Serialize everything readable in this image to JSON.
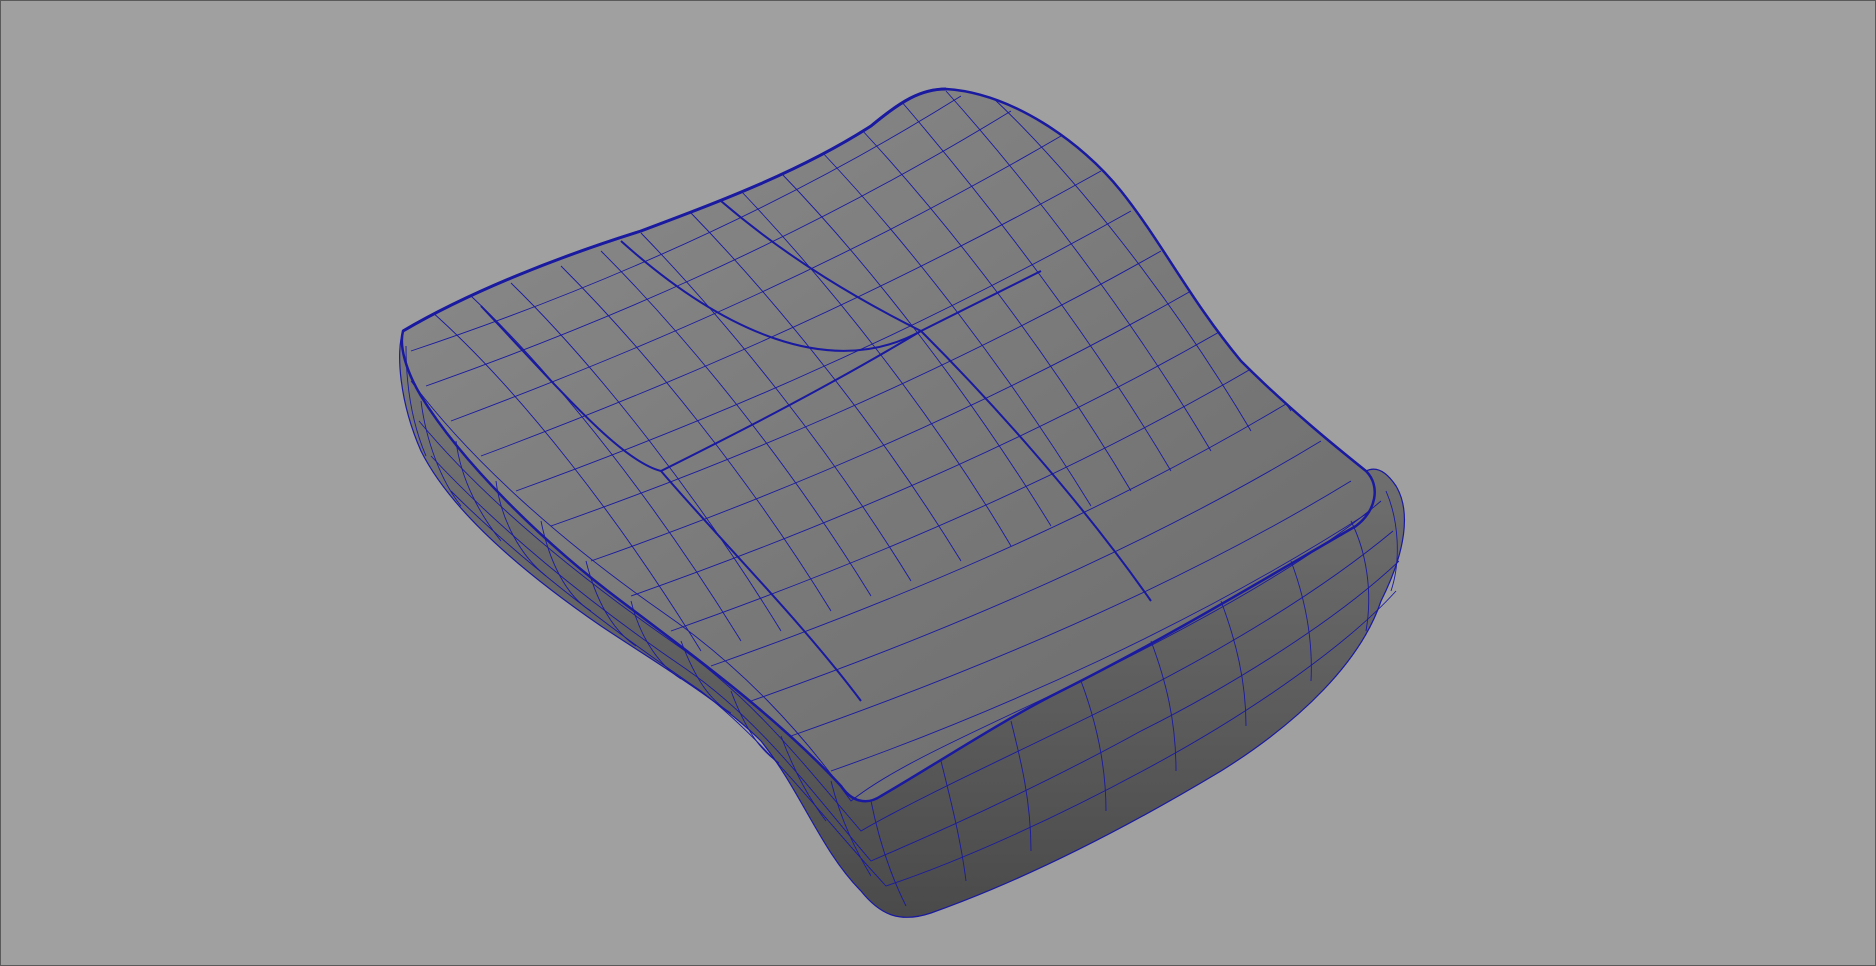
{
  "viewport": {
    "background_color": "#a0a0a0",
    "border_color": "#5a5a5a"
  },
  "model": {
    "shape": "seat-cushion",
    "display_mode": "smooth-shaded-with-wireframe-on-shaded",
    "surface_color": "#6f6f6f",
    "surface_highlight_color": "#8a8a8a",
    "surface_shadow_color": "#4e4e4e",
    "wireframe_color": "#1a1aa0"
  }
}
